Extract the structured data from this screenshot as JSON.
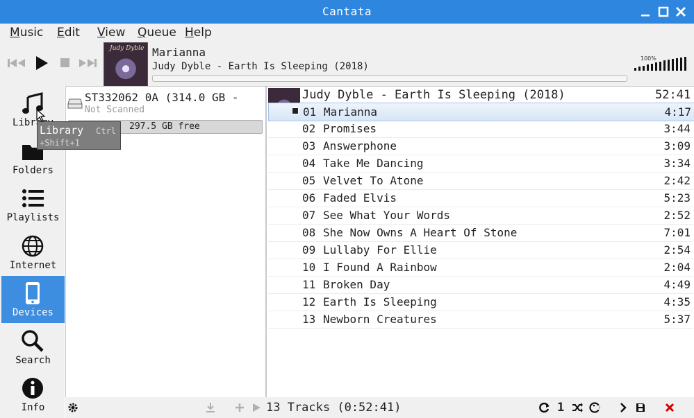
{
  "window": {
    "title": "Cantata"
  },
  "menu": {
    "items": [
      "Music",
      "Edit",
      "View",
      "Queue",
      "Help"
    ]
  },
  "now_playing": {
    "title": "Marianna",
    "artist_album": "Judy Dyble - Earth Is Sleeping (2018)",
    "cover_text": "Judy Dyble",
    "progress": 0.0,
    "volume_label": "100%"
  },
  "sidebar": {
    "items": [
      {
        "label": "Library",
        "icon": "music-note-icon"
      },
      {
        "label": "Folders",
        "icon": "folder-icon"
      },
      {
        "label": "Playlists",
        "icon": "list-icon"
      },
      {
        "label": "Internet",
        "icon": "globe-icon"
      },
      {
        "label": "Devices",
        "icon": "phone-icon",
        "active": true
      },
      {
        "label": "Search",
        "icon": "search-icon"
      },
      {
        "label": "Info",
        "icon": "info-icon"
      }
    ]
  },
  "tooltip": {
    "title": "Library",
    "shortcut_1": "Ctrl",
    "shortcut_2": "+Shift+1"
  },
  "device": {
    "name": "ST332062 0A (314.0 GB -",
    "status": "Not Scanned",
    "free": "297.5 GB free"
  },
  "playlist": {
    "album_header": "Judy Dyble - Earth Is Sleeping (2018)",
    "album_length": "52:41",
    "tracks": [
      {
        "num": "01",
        "title": "Marianna",
        "length": "4:17"
      },
      {
        "num": "02",
        "title": "Promises",
        "length": "3:44"
      },
      {
        "num": "03",
        "title": "Answerphone",
        "length": "3:09"
      },
      {
        "num": "04",
        "title": "Take Me Dancing",
        "length": "3:34"
      },
      {
        "num": "05",
        "title": "Velvet To Atone",
        "length": "2:42"
      },
      {
        "num": "06",
        "title": "Faded Elvis",
        "length": "5:23"
      },
      {
        "num": "07",
        "title": "See What Your Words",
        "length": "2:52"
      },
      {
        "num": "08",
        "title": "She Now Owns A Heart Of Stone",
        "length": "7:01"
      },
      {
        "num": "09",
        "title": "Lullaby For Ellie",
        "length": "2:54"
      },
      {
        "num": "10",
        "title": "I Found A Rainbow",
        "length": "2:04"
      },
      {
        "num": "11",
        "title": "Broken Day",
        "length": "4:49"
      },
      {
        "num": "12",
        "title": "Earth Is Sleeping",
        "length": "4:35"
      },
      {
        "num": "13",
        "title": "Newborn Creatures",
        "length": "5:37"
      }
    ]
  },
  "status": {
    "summary": "13 Tracks (0:52:41)",
    "single_label": "1"
  },
  "colors": {
    "accent": "#2e86de",
    "active_sidebar": "#3d8ee0",
    "stop_red": "#d40000"
  }
}
